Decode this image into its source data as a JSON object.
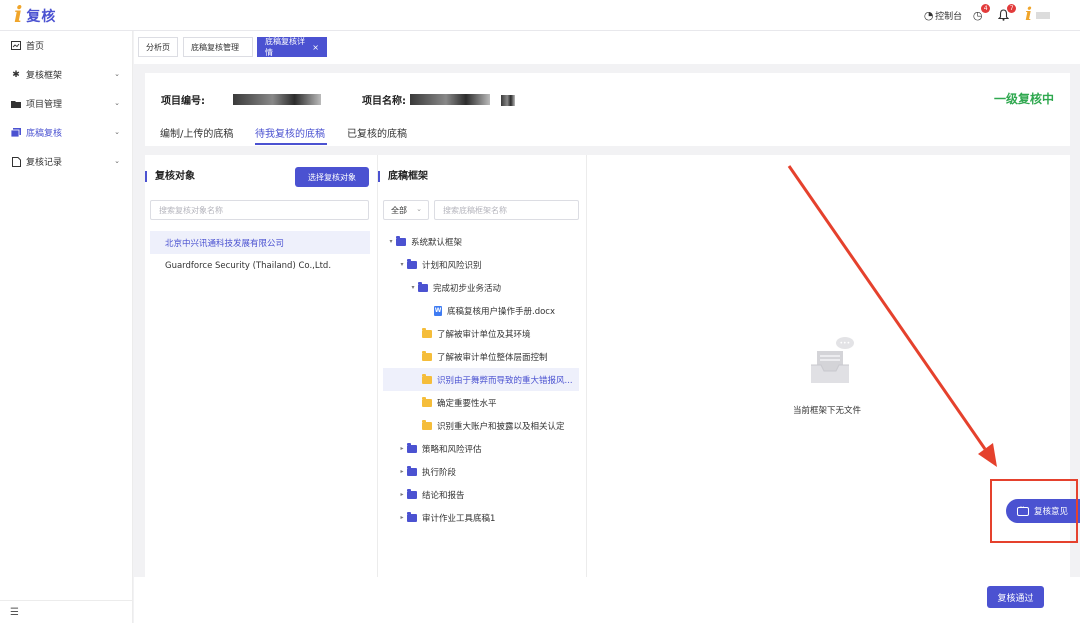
{
  "header": {
    "logo_mark": "i",
    "logo_text": "复核",
    "console_label": "控制台",
    "history_badge": "4",
    "notification_badge": "7",
    "user_mark": "i"
  },
  "sidebar": {
    "items": [
      {
        "label": "首页",
        "icon": "dashboard-icon"
      },
      {
        "label": "复核框架",
        "icon": "gear-icon"
      },
      {
        "label": "项目管理",
        "icon": "folder-icon"
      },
      {
        "label": "底稿复核",
        "icon": "copy-icon"
      },
      {
        "label": "复核记录",
        "icon": "document-icon"
      }
    ],
    "collapse_icon": "menu-collapse-icon"
  },
  "tabs": [
    {
      "label": "分析页"
    },
    {
      "label": "底稿复核管理"
    },
    {
      "label": "底稿复核详情",
      "close": "×"
    }
  ],
  "project": {
    "number_label": "项目编号:",
    "name_label": "项目名称:",
    "status": "一级复核中",
    "status_color": "#2fa84f",
    "subtabs": [
      "编制/上传的底稿",
      "待我复核的底稿",
      "已复核的底稿"
    ]
  },
  "review_objects": {
    "title": "复核对象",
    "select_button": "选择复核对象",
    "search_placeholder": "搜索复核对象名称",
    "items": [
      "北京中兴讯通科技发展有限公司",
      "Guardforce Security (Thailand) Co.,Ltd."
    ]
  },
  "framework": {
    "title": "底稿框架",
    "filter_value": "全部",
    "search_placeholder": "搜索底稿框架名称",
    "tree": [
      {
        "label": "系统默认框架",
        "caret": "▾"
      },
      {
        "label": "计划和风险识别",
        "caret": "▾"
      },
      {
        "label": "完成初步业务活动",
        "caret": "▾"
      },
      {
        "label": "底稿复核用户操作手册.docx",
        "doc": "W"
      },
      {
        "label": "了解被审计单位及其环境"
      },
      {
        "label": "了解被审计单位整体层面控制"
      },
      {
        "label": "识别由于舞弊而导致的重大错报风..."
      },
      {
        "label": "确定重要性水平"
      },
      {
        "label": "识别重大账户和披露以及相关认定"
      },
      {
        "label": "策略和风险评估",
        "caret": "▸"
      },
      {
        "label": "执行阶段",
        "caret": "▸"
      },
      {
        "label": "结论和报告",
        "caret": "▸"
      },
      {
        "label": "审计作业工具底稿1",
        "caret": "▸"
      }
    ]
  },
  "preview": {
    "empty_text": "当前框架下无文件"
  },
  "actions": {
    "opinion_label": "复核意见",
    "approve_label": "复核通过"
  },
  "colors": {
    "primary": "#4b52d1",
    "annotation": "#e5412d"
  }
}
